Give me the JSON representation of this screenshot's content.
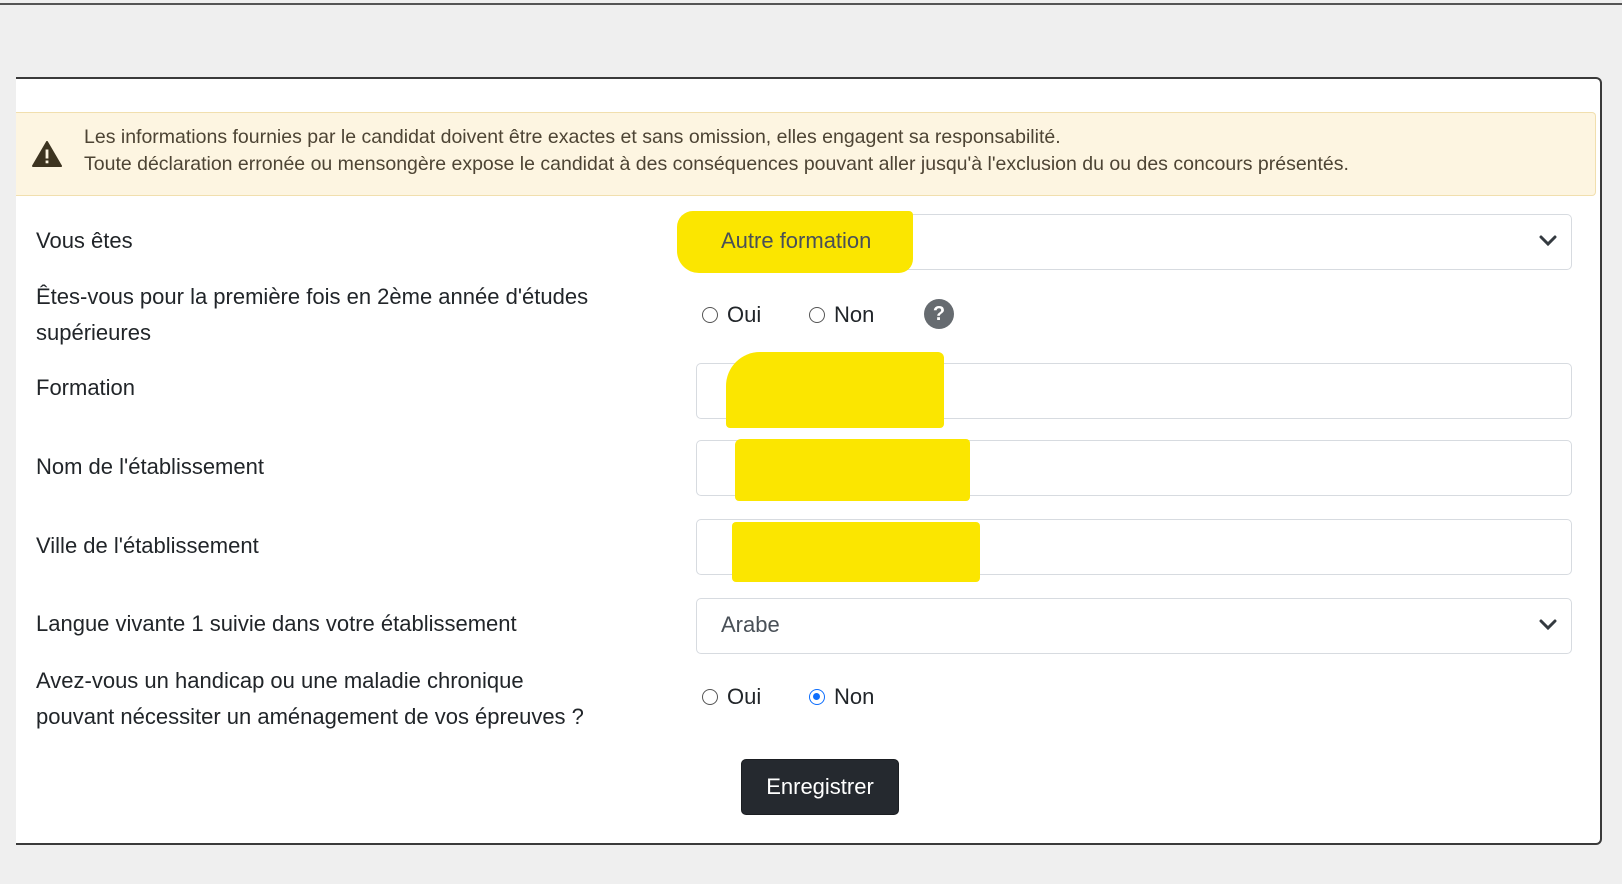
{
  "alert": {
    "line1": "Les informations fournies par le candidat doivent être exactes et sans omission, elles engagent sa responsabilité.",
    "line2": "Toute déclaration erronée ou mensongère expose le candidat à des conséquences pouvant aller jusqu'à l'exclusion du ou des concours présentés.",
    "icon": "warning-triangle-icon",
    "background_color": "#fdf5e1"
  },
  "form": {
    "vous_etes": {
      "label": "Vous êtes",
      "value": "Autre formation"
    },
    "premiere_fois": {
      "label_line1": "Êtes-vous pour la première fois en 2ème année d'études",
      "label_line2": "supérieures",
      "options": [
        "Oui",
        "Non"
      ],
      "selected": null,
      "help_icon_text": "?"
    },
    "formation": {
      "label": "Formation",
      "value": ""
    },
    "nom_etablissement": {
      "label": "Nom de l'établissement",
      "value": ""
    },
    "ville_etablissement": {
      "label": "Ville de l'établissement",
      "value": ""
    },
    "langue_vivante": {
      "label": "Langue vivante 1 suivie dans votre établissement",
      "value": "Arabe"
    },
    "handicap": {
      "label_line1": "Avez-vous un handicap ou une maladie chronique",
      "label_line2": "pouvant nécessiter un aménagement de vos épreuves ?",
      "options": [
        "Oui",
        "Non"
      ],
      "selected": "Non"
    },
    "save_label": "Enregistrer"
  },
  "colors": {
    "highlight": "#fbe600",
    "button": "#25292f",
    "radio_checked": "#0d6efd"
  }
}
